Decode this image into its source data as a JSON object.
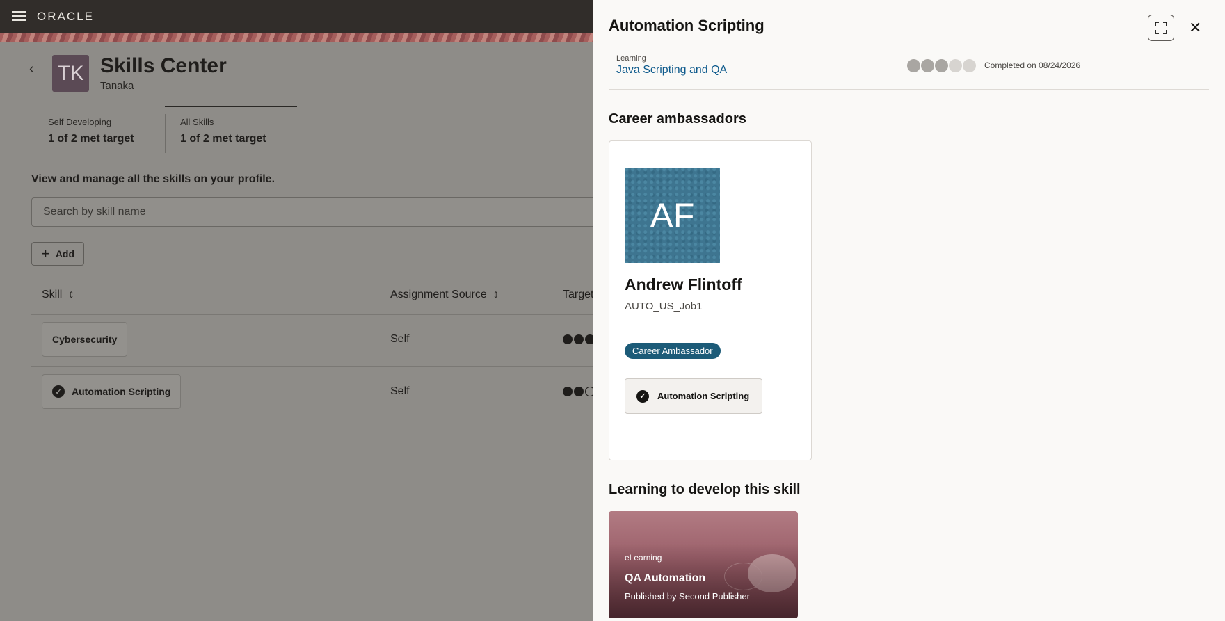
{
  "header": {
    "brand": "ORACLE"
  },
  "profile": {
    "initials": "TK",
    "title": "Skills Center",
    "subtitle": "Tanaka"
  },
  "stats": [
    {
      "label": "Self Developing",
      "value": "1 of 2 met target"
    },
    {
      "label": "All Skills",
      "value": "1 of 2 met target"
    }
  ],
  "intro": "View and manage all the skills on your profile.",
  "search": {
    "placeholder": "Search by skill name"
  },
  "add_label": "Add",
  "table": {
    "columns": [
      "Skill",
      "Assignment Source",
      "Target"
    ],
    "rows": [
      {
        "skill": "Cybersecurity",
        "source": "Self",
        "verified": false,
        "target_level": 3,
        "target_max": 3
      },
      {
        "skill": "Automation Scripting",
        "source": "Self",
        "verified": true,
        "target_level": 2,
        "target_max": 3
      }
    ]
  },
  "drawer": {
    "title": "Automation Scripting",
    "learning": {
      "label": "Learning",
      "link": "Java Scripting and QA",
      "proficiency_filled": 3,
      "proficiency_total": 5,
      "completed": "Completed on 08/24/2026"
    },
    "ambassadors_title": "Career ambassadors",
    "ambassador": {
      "initials": "AF",
      "name": "Andrew Flintoff",
      "job": "AUTO_US_Job1",
      "badge": "Career Ambassador",
      "skill": "Automation Scripting"
    },
    "learning_title": "Learning to develop this skill",
    "course": {
      "type": "eLearning",
      "title": "QA Automation",
      "publisher": "Published by Second Publisher"
    }
  },
  "colors": {
    "topbar": "#312d2a",
    "link": "#0e5a8c",
    "badge": "#1c5b78",
    "avatar_tk": "#5b4a55",
    "avatar_af": "#3e7590"
  }
}
